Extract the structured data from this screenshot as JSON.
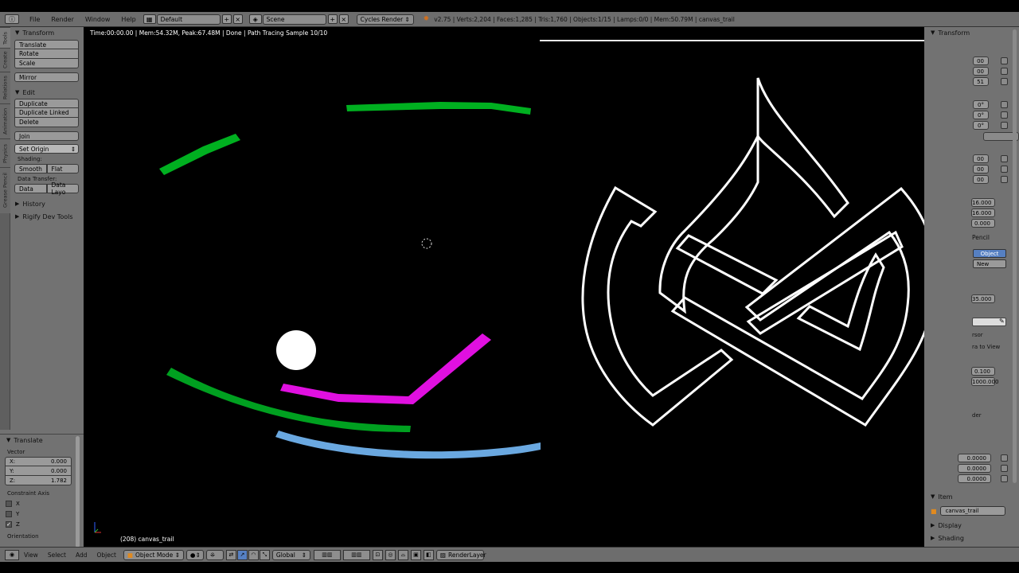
{
  "topbar": {
    "menus": [
      "File",
      "Render",
      "Window",
      "Help"
    ],
    "layout": "Default",
    "scene": "Scene",
    "engine": "Cycles Render",
    "stats": "v2.75 | Verts:2,204 | Faces:1,285 | Tris:1,760 | Objects:1/15 | Lamps:0/0 | Mem:50.79M | canvas_trail"
  },
  "tabs": [
    "Tools",
    "Create",
    "Relations",
    "Animation",
    "Physics",
    "Grease Pencil"
  ],
  "toolshelf": {
    "transform_title": "Transform",
    "translate": "Translate",
    "rotate": "Rotate",
    "scale": "Scale",
    "mirror": "Mirror",
    "edit_title": "Edit",
    "duplicate": "Duplicate",
    "duplicate_linked": "Duplicate Linked",
    "delete": "Delete",
    "join": "Join",
    "set_origin": "Set Origin",
    "shading_label": "Shading:",
    "smooth": "Smooth",
    "flat": "Flat",
    "data_transfer_label": "Data Transfer:",
    "data": "Data",
    "data_layout": "Data Layo",
    "history": "History",
    "rigify": "Rigify Dev Tools"
  },
  "operator": {
    "title": "Translate",
    "vector_label": "Vector",
    "x_label": "X:",
    "x": "0.000",
    "y_label": "Y:",
    "y": "0.000",
    "z_label": "Z:",
    "z": "1.782",
    "constraint_label": "Constraint Axis",
    "cx": "X",
    "cy": "Y",
    "cz": "Z",
    "orientation": "Orientation"
  },
  "viewport": {
    "status": "Time:00:00.00 | Mem:54.32M, Peak:67.48M | Done | Path Tracing Sample 10/10",
    "object_label": "(208) canvas_trail"
  },
  "props": {
    "transform_title": "Transform",
    "dim1": "16.000",
    "dim2": "16.000",
    "dim3": "0.000",
    "pencil": "Pencil",
    "object_btn": "Object",
    "new_btn": "New",
    "lens": "35.000",
    "rsor": "rsor",
    "ra_to_view": "ra to View",
    "clip_start": "0.100",
    "clip_end": "1000.000",
    "der": "der",
    "v1": "0.0000",
    "v2": "0.0000",
    "v3": "0.0000",
    "item_title": "Item",
    "item_name": "canvas_trail",
    "display": "Display",
    "shading": "Shading",
    "partial": [
      "00",
      "00",
      "51",
      "0°",
      "0°",
      "0°",
      "00",
      "00",
      "00"
    ]
  },
  "bottombar": {
    "view": "View",
    "select": "Select",
    "add": "Add",
    "object": "Object",
    "mode": "Object Mode",
    "orientation": "Global",
    "renderlayer": "RenderLayer"
  },
  "colors": {
    "green": "#00b020",
    "magenta": "#e010e0",
    "blue": "#6aa8e0",
    "white": "#ffffff"
  }
}
